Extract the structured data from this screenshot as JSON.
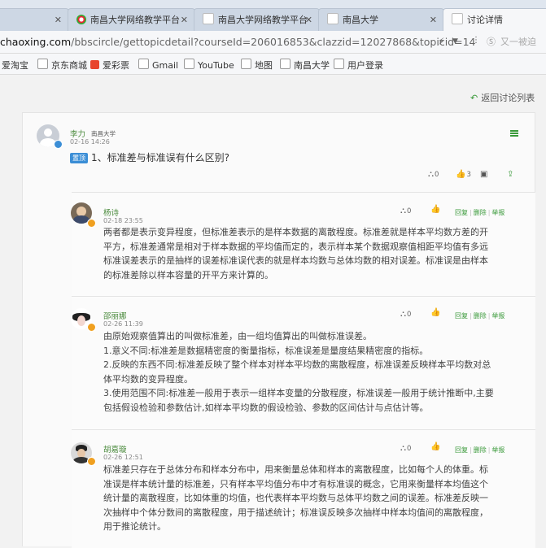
{
  "tabs": [
    {
      "label": "",
      "active": false
    },
    {
      "label": "南昌大学网络教学平台",
      "active": false
    },
    {
      "label": "南昌大学网络教学平台",
      "active": false
    },
    {
      "label": "南昌大学",
      "active": false
    },
    {
      "label": "讨论详情",
      "active": true
    }
  ],
  "address": {
    "host": "chaoxing.com",
    "path": "/bbscircle/gettopicdetail?courseId=206016853&clazzid=12027868&topicid=14",
    "search_placeholder": "又一被迫"
  },
  "bookmarks": [
    {
      "label": "爱淘宝",
      "color": "#ff5000"
    },
    {
      "label": "京东商城",
      "color": "#d0d0d0"
    },
    {
      "label": "爱彩票",
      "color": "#e8442c"
    },
    {
      "label": "Gmail",
      "color": "#d0d0d0"
    },
    {
      "label": "YouTube",
      "color": "#d0d0d0"
    },
    {
      "label": "地图",
      "color": "#d0d0d0"
    },
    {
      "label": "南昌大学",
      "color": "#d0d0d0"
    },
    {
      "label": "用户登录",
      "color": "#d0d0d0"
    }
  ],
  "back_link": "返回讨论列表",
  "topic": {
    "author": "李力",
    "school": "南昌大学",
    "time": "02-16 14:26",
    "tag": "置顶",
    "title": "1、标准差与标准误有什么区别?",
    "stats": {
      "views": "0",
      "likes": "3",
      "comments": "",
      "share": ""
    }
  },
  "replies": [
    {
      "author": "杨诗",
      "time": "02-18 23:55",
      "count": "0",
      "actions": [
        "回复",
        "删除",
        "举报"
      ],
      "lines": [
        "两者都是表示变异程度，但标准差表示的是样本数据的离散程度。标准差就是样本平均数方差的开",
        "平方，标准差通常是相对于样本数据的平均值而定的，表示样本某个数据观察值相距平均值有多远",
        "标准误差表示的是抽样的误差标准误代表的就是样本均数与总体均数的相对误差。标准误是由样本",
        "的标准差除以样本容量的开平方来计算的。"
      ]
    },
    {
      "author": "邵丽娜",
      "time": "02-26 11:39",
      "count": "0",
      "actions": [
        "回复",
        "删除",
        "举报"
      ],
      "lines": [
        "由原始观察值算出的叫做标准差，由一组均值算出的叫做标准误差。",
        "1.意义不同:标准差是数据精密度的衡量指标，标准误差是量度结果精密度的指标。",
        "2.反映的东西不同:标准差反映了整个样本对样本平均数的离散程度，标准误差反映样本平均数对总",
        "体平均数的变异程度。",
        "3.使用范围不同:标准差一般用于表示一组样本变量的分散程度，标准误差一般用于统计推断中,主要",
        "包括假设检验和参数估计,如样本平均数的假设检验、参数的区间估计与点估计等。"
      ]
    },
    {
      "author": "胡嘉璇",
      "time": "02-26 12:51",
      "count": "0",
      "actions": [
        "回复",
        "删除",
        "举报"
      ],
      "lines": [
        "标准差只存在于总体分布和样本分布中，用来衡量总体和样本的离散程度，比如每个人的体重。标",
        "准误是样本统计量的标准差，只有样本平均值分布中才有标准误的概念，它用来衡量样本均值这个",
        "统计量的离散程度，比如体重的均值，也代表样本平均数与总体平均数之间的误差。标准差反映一",
        "次抽样中个体分数间的离散程度，用于描述统计；标准误反映多次抽样中样本均值间的离散程度，",
        "用于推论统计。"
      ]
    }
  ]
}
